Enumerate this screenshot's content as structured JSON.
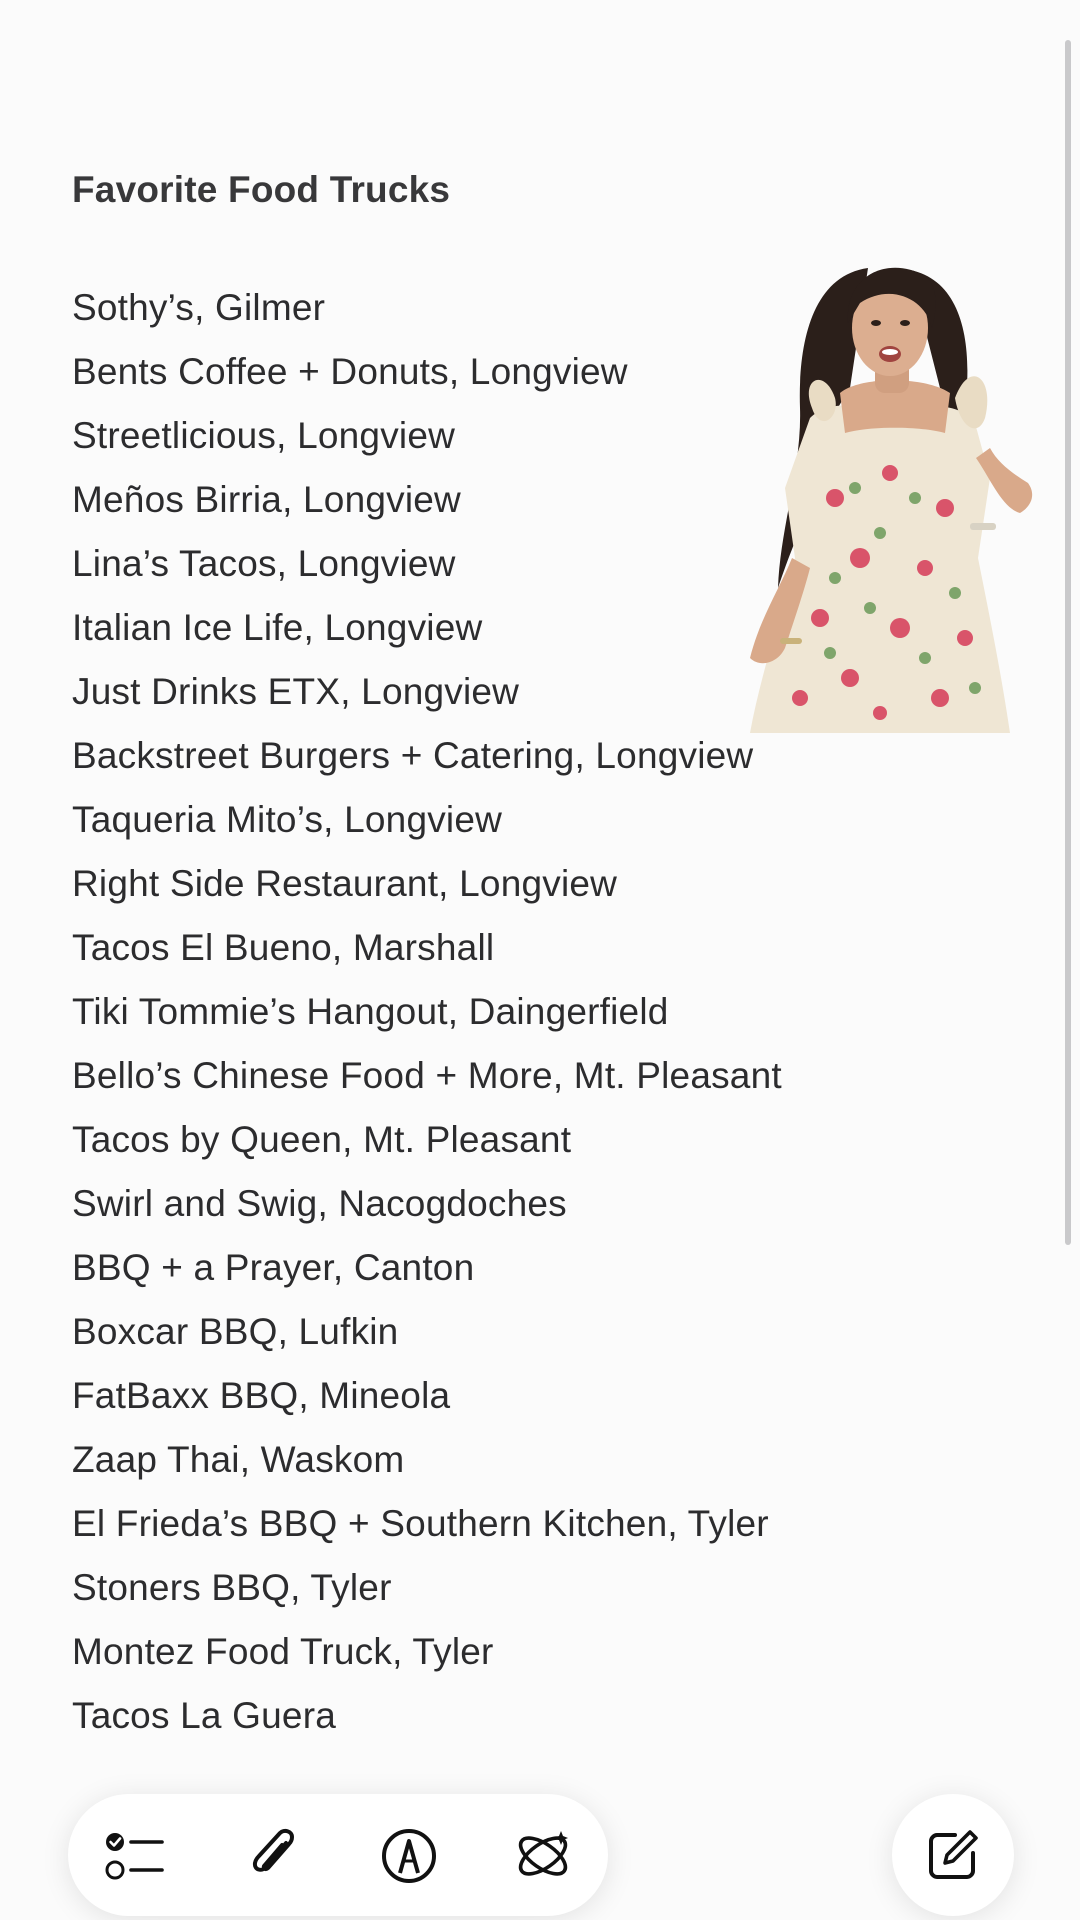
{
  "note": {
    "title": "Favorite Food Trucks",
    "lines": [
      "Sothy’s, Gilmer",
      "Bents Coffee + Donuts, Longview",
      "Streetlicious, Longview",
      "Meños Birria, Longview",
      "Lina’s Tacos, Longview",
      "Italian Ice Life, Longview",
      "Just Drinks ETX, Longview",
      "Backstreet Burgers + Catering, Longview",
      "Taqueria Mito’s, Longview",
      "Right Side Restaurant, Longview",
      "Tacos El Bueno, Marshall",
      "Tiki Tommie’s Hangout, Daingerfield",
      "Bello’s Chinese Food + More, Mt. Pleasant",
      "Tacos by Queen, Mt. Pleasant",
      "Swirl and Swig, Nacogdoches",
      "BBQ + a Prayer, Canton",
      "Boxcar BBQ, Lufkin",
      "FatBaxx BBQ, Mineola",
      "Zaap Thai, Waskom",
      "El Frieda’s BBQ + Southern Kitchen, Tyler",
      "Stoners BBQ, Tyler",
      "Montez Food Truck, Tyler",
      "Tacos La Guera"
    ]
  },
  "toolbar": {
    "icons": [
      "checklist-icon",
      "paperclip-icon",
      "markup-pen-icon",
      "apple-intelligence-icon"
    ]
  },
  "compose": {
    "icon": "compose-icon"
  },
  "colors": {
    "background": "#fbfbfb",
    "text": "#2c2c2e",
    "title": "#38383a",
    "icon": "#111111"
  }
}
